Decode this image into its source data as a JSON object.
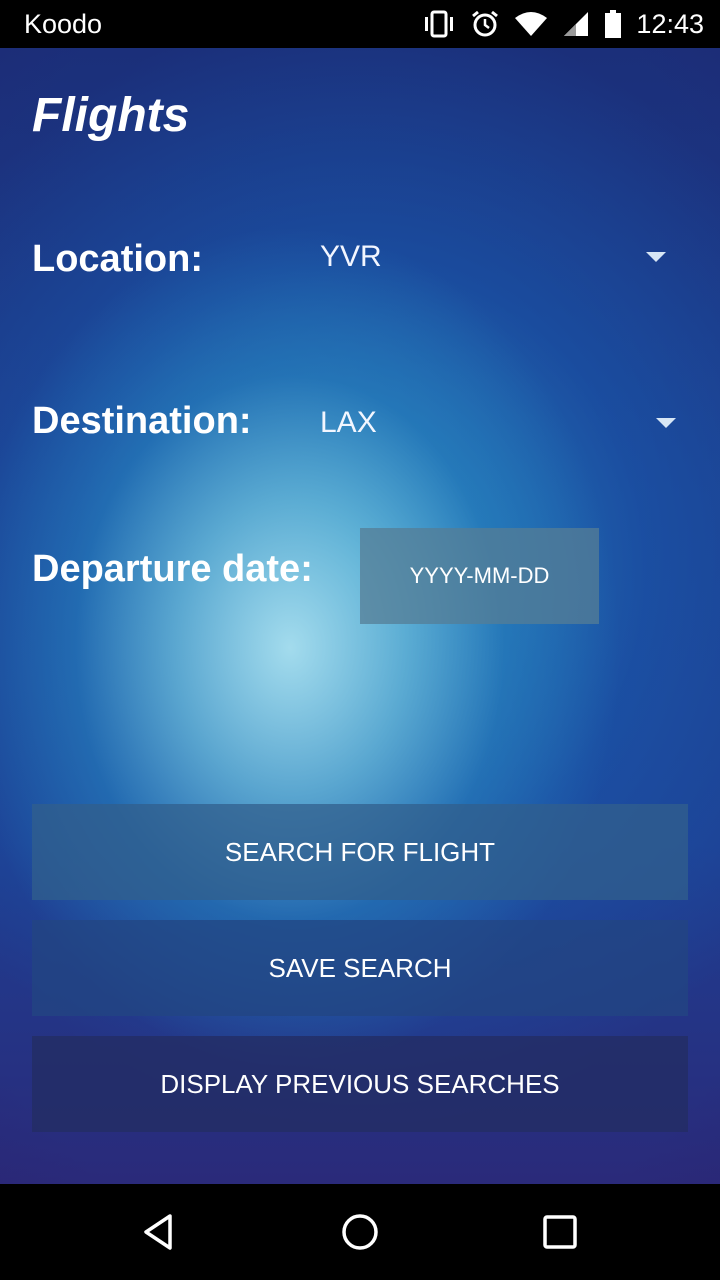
{
  "status_bar": {
    "carrier": "Koodo",
    "time": "12:43",
    "icons": [
      "vibrate-icon",
      "alarm-icon",
      "wifi-icon",
      "signal-icon",
      "battery-icon"
    ]
  },
  "app": {
    "title": "Flights",
    "location": {
      "label": "Location:",
      "value": "YVR"
    },
    "destination": {
      "label": "Destination:",
      "value": "LAX"
    },
    "departure": {
      "label": "Departure date:",
      "button": "YYYY-MM-DD"
    },
    "buttons": {
      "search": "SEARCH FOR FLIGHT",
      "save": "SAVE SEARCH",
      "display": "DISPLAY PREVIOUS SEARCHES"
    }
  },
  "nav_bar": {
    "icons": [
      "back-icon",
      "home-icon",
      "recents-icon"
    ]
  },
  "colors": {
    "status_bar": "#000000",
    "text": "#ffffff",
    "background_deep": "#1d3c8c",
    "background_glow": "#9fd8ea"
  }
}
